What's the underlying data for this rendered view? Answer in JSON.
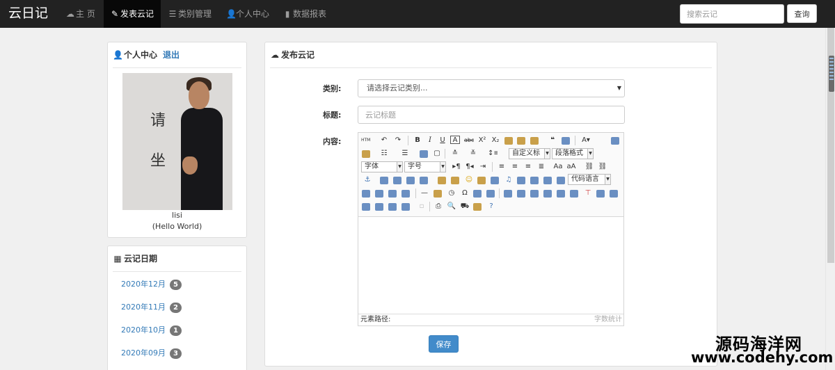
{
  "app": {
    "title": "云日记"
  },
  "nav": {
    "items": [
      {
        "icon": "cloud-icon",
        "label": "主 页"
      },
      {
        "icon": "pencil-icon",
        "label": "发表云记"
      },
      {
        "icon": "list-icon",
        "label": "类别管理"
      },
      {
        "icon": "user-icon",
        "label": "个人中心"
      },
      {
        "icon": "bar-chart-icon",
        "label": "数据报表"
      }
    ],
    "active": "发表云记"
  },
  "search": {
    "placeholder": "搜索云记",
    "button": "查询"
  },
  "profile": {
    "title": "个人中心",
    "logout": "退出",
    "avatar_text": [
      "请",
      "坐"
    ],
    "username": "lisi",
    "motto": "(Hello World)"
  },
  "dates": {
    "title": "云记日期",
    "items": [
      {
        "label": "2020年12月",
        "count": "5"
      },
      {
        "label": "2020年11月",
        "count": "2"
      },
      {
        "label": "2020年10月",
        "count": "1"
      },
      {
        "label": "2020年09月",
        "count": "3"
      }
    ]
  },
  "post": {
    "title": "发布云记",
    "category_label": "类别:",
    "category_value": "请选择云记类别...",
    "title_label": "标题:",
    "title_placeholder": "云记标题",
    "content_label": "内容:",
    "save": "保存"
  },
  "editor": {
    "combos": {
      "custom_title": "自定义标",
      "paragraph": "段落格式",
      "font": "字体",
      "size": "字号",
      "code": "代码语言"
    },
    "status_path": "元素路径:",
    "word_count": "字数统计"
  },
  "watermark": {
    "line1": "源码海洋网",
    "line2": "www.codehy.com"
  }
}
